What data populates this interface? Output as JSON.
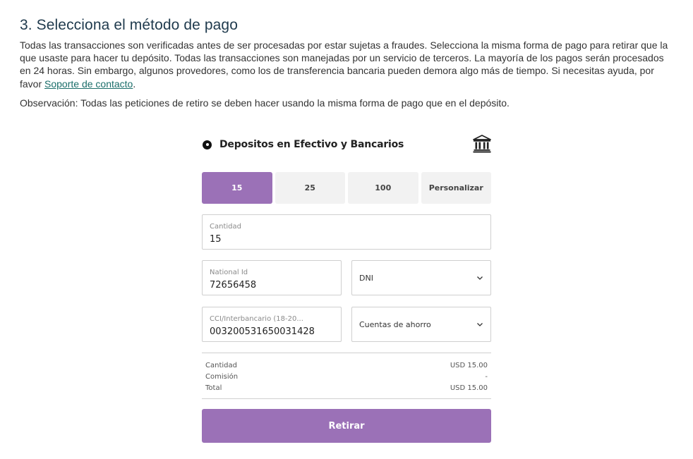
{
  "section": {
    "title": "3. Selecciona el método de pago",
    "paragraph": "Todas las transacciones son verificadas antes de ser procesadas por estar sujetas a fraudes. Selecciona la misma forma de pago para retirar que la que usaste para hacer tu depósito. Todas las transacciones son manejadas por un servicio de terceros. La mayoría de los pagos serán procesados en 24 horas. Sin embargo, algunos provedores, como los de transferencia bancaria pueden demora algo más de tiempo. Si necesitas ayuda, por favor",
    "support_link": "Soporte de contacto",
    "paragraph_end": ".",
    "note": "Observación: Todas las peticiones de retiro se deben hacer usando la misma forma de pago que en el depósito."
  },
  "method": {
    "label": "Depositos en Efectivo y Bancarios",
    "icon": "bank-icon",
    "selected": true
  },
  "amounts": [
    {
      "label": "15",
      "active": true
    },
    {
      "label": "25",
      "active": false
    },
    {
      "label": "100",
      "active": false
    },
    {
      "label": "Personalizar",
      "active": false
    }
  ],
  "form": {
    "amount_label": "Cantidad",
    "amount_value": "15",
    "national_id_label": "National Id",
    "national_id_value": "72656458",
    "id_type_value": "DNI",
    "cci_label": "CCI/Interbancario (18-20...",
    "cci_value": "003200531650031428",
    "account_type_value": "Cuentas de ahorro"
  },
  "summary": {
    "amount_label": "Cantidad",
    "amount_value": "USD 15.00",
    "fee_label": "Comisión",
    "fee_value": "-",
    "total_label": "Total",
    "total_value": "USD 15.00"
  },
  "submit_label": "Retirar",
  "colors": {
    "accent": "#9b71b7",
    "heading": "#1f3a4d",
    "link": "#1b6e6a"
  }
}
